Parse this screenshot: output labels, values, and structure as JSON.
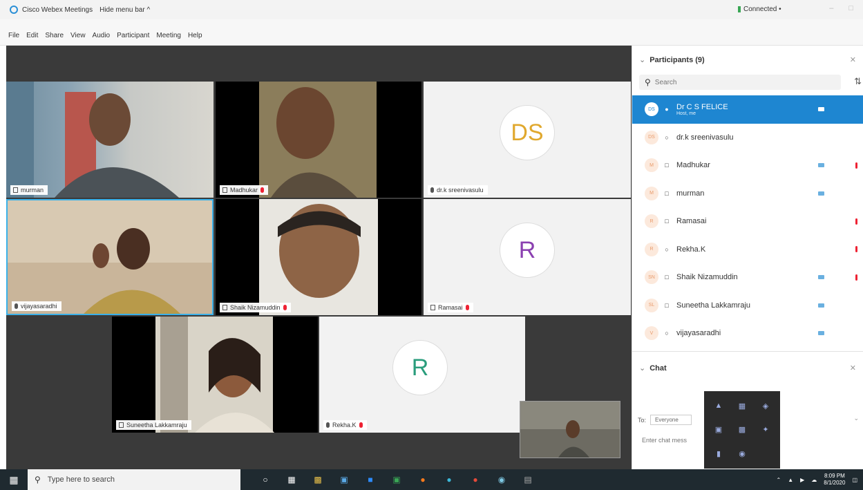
{
  "window": {
    "title": "Cisco Webex Meetings",
    "hide_menu": "Hide menu bar ^",
    "status": "Connected •"
  },
  "menu": [
    "File",
    "Edit",
    "Share",
    "View",
    "Audio",
    "Participant",
    "Meeting",
    "Help"
  ],
  "tiles": {
    "murman": "murman",
    "madhukar": "Madhukar",
    "sreenivasulu": "dr.k sreenivasulu",
    "sreenivasulu_initials": "DS",
    "vijayasaradhi": "vijayasaradhi",
    "shaik": "Shaik Nizamuddin",
    "ramasai": "Ramasai",
    "ramasai_initial": "R",
    "suneetha": "Suneetha Lakkamraju",
    "rekha": "Rekha.K",
    "rekha_initial": "R"
  },
  "participants_panel": {
    "title": "Participants (9)",
    "search_placeholder": "Search",
    "items": [
      {
        "initials": "DS",
        "name": "Dr C S FELICE",
        "sub": "Host, me",
        "cam": true,
        "muted": false,
        "active": true
      },
      {
        "initials": "DS",
        "name": "dr.k sreenivasulu",
        "sub": "",
        "cam": false,
        "muted": false,
        "active": false
      },
      {
        "initials": "M",
        "name": "Madhukar",
        "sub": "",
        "cam": true,
        "muted": true,
        "active": false
      },
      {
        "initials": "M",
        "name": "murman",
        "sub": "",
        "cam": true,
        "muted": false,
        "active": false
      },
      {
        "initials": "R",
        "name": "Ramasai",
        "sub": "",
        "cam": false,
        "muted": true,
        "active": false
      },
      {
        "initials": "R",
        "name": "Rekha.K",
        "sub": "",
        "cam": false,
        "muted": true,
        "active": false
      },
      {
        "initials": "SN",
        "name": "Shaik Nizamuddin",
        "sub": "",
        "cam": true,
        "muted": true,
        "active": false
      },
      {
        "initials": "SL",
        "name": "Suneetha Lakkamraju",
        "sub": "",
        "cam": true,
        "muted": false,
        "active": false
      },
      {
        "initials": "V",
        "name": "vijayasaradhi",
        "sub": "",
        "cam": true,
        "muted": false,
        "active": false
      }
    ]
  },
  "chat_panel": {
    "title": "Chat",
    "to_label": "To:",
    "to_value": "Everyone",
    "placeholder": "Enter chat mess"
  },
  "taskbar": {
    "search_placeholder": "Type here to search",
    "time": "8:09 PM",
    "date": "8/1/2020"
  },
  "colors": {
    "accent": "#1e86d1",
    "ds_initials": "#e0a82e",
    "ramasai_initial": "#8a3fb0",
    "rekha_initial": "#2a9d7c",
    "active_speaker_border": "#3ab0e8"
  }
}
